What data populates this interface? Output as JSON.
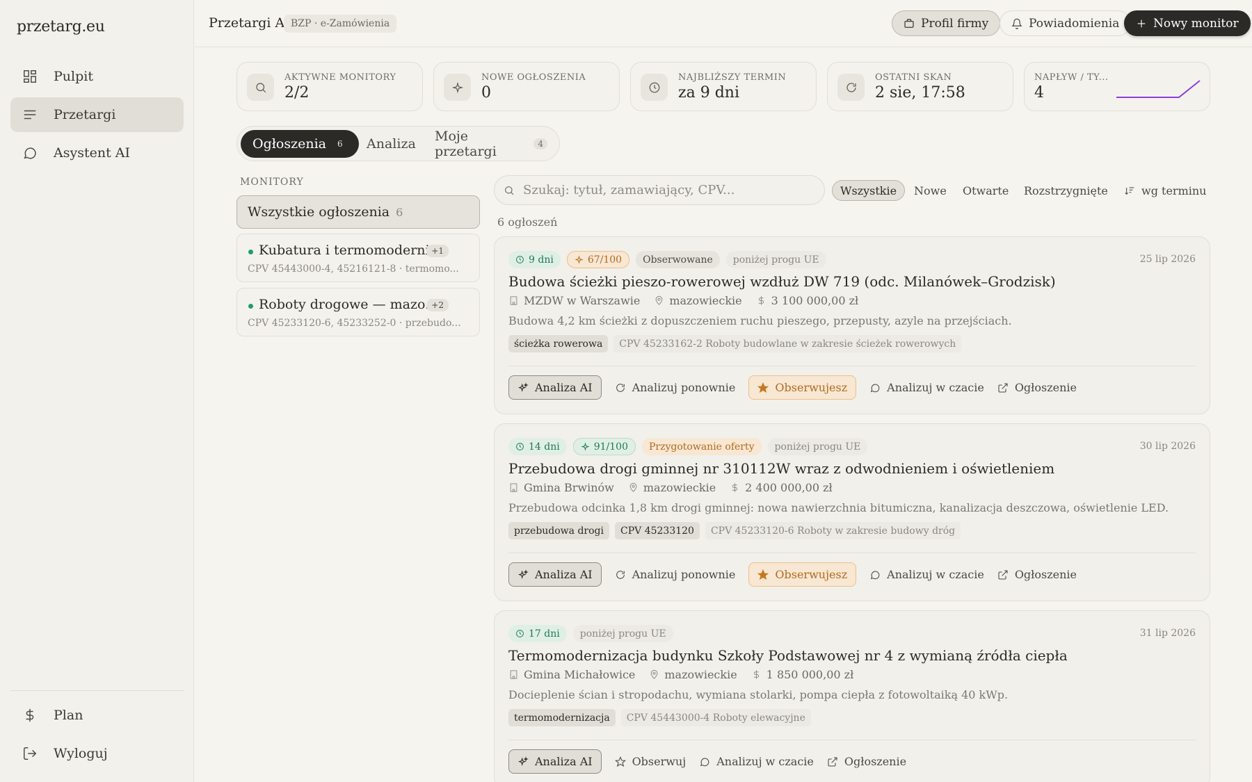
{
  "app": {
    "logo": "przetarg.eu",
    "title": "Przetargi AI",
    "source_badge": "BZP · e-Zamówienia"
  },
  "sidebar": {
    "items": [
      {
        "label": "Pulpit",
        "icon": "dashboard-icon"
      },
      {
        "label": "Przetargi",
        "icon": "list-icon",
        "active": true
      },
      {
        "label": "Asystent AI",
        "icon": "chat-icon"
      }
    ],
    "bottom": [
      {
        "label": "Plan",
        "icon": "dollar-icon"
      },
      {
        "label": "Wyloguj",
        "icon": "logout-icon"
      }
    ]
  },
  "header": {
    "profile_label": "Profil firmy",
    "notifications_label": "Powiadomienia",
    "new_monitor_label": "Nowy monitor"
  },
  "stats": [
    {
      "label": "Aktywne monitory",
      "value": "2/2",
      "icon": "search-icon"
    },
    {
      "label": "Nowe ogłoszenia",
      "value": "0",
      "icon": "sparkle-icon"
    },
    {
      "label": "Najbliższy termin",
      "value": "za 9 dni",
      "icon": "clock-icon"
    },
    {
      "label": "Ostatni skan",
      "value": "2 sie, 17:58",
      "icon": "refresh-icon"
    },
    {
      "label": "Napływ / ty...",
      "value": "4",
      "icon": "sparkline"
    }
  ],
  "tabs": [
    {
      "label": "Ogłoszenia",
      "count": "6",
      "active": true
    },
    {
      "label": "Analiza",
      "count": ""
    },
    {
      "label": "Moje przetargi",
      "count": "4"
    }
  ],
  "monitors": {
    "title": "MONITORY",
    "all_label": "Wszystkie ogłoszenia",
    "all_count": "6",
    "items": [
      {
        "name": "Kubatura i termomoderni...",
        "extra": "+1",
        "cpv": "CPV 45443000-4, 45216121-8 · termomo..."
      },
      {
        "name": "Roboty drogowe — mazo...",
        "extra": "+2",
        "cpv": "CPV 45233120-6, 45233252-0 · przebudo..."
      }
    ]
  },
  "search": {
    "placeholder": "Szukaj: tytuł, zamawiający, CPV..."
  },
  "filters": [
    "Wszystkie",
    "Nowe",
    "Otwarte",
    "Rozstrzygnięte"
  ],
  "sort_label": "wg terminu",
  "results_count": "6 ogłoszeń",
  "actions": {
    "analysis": "Analiza AI",
    "reanalyze": "Analizuj ponownie",
    "watching": "Obserwujesz",
    "watch": "Obserwuj",
    "live": "Analizuj w czacie",
    "notice": "Ogłoszenie"
  },
  "tenders": [
    {
      "days": "9 dni",
      "score": "67/100",
      "status": "Obserwowane",
      "threshold": "poniżej progu UE",
      "date": "25 lip 2026",
      "title": "Budowa ścieżki pieszo-rowerowej wzdłuż DW 719 (odc. Milanówek–Grodzisk)",
      "buyer": "MZDW w Warszawie",
      "region": "mazowieckie",
      "value": "3 100 000,00 zł",
      "desc": "Budowa 4,2 km ścieżki z dopuszczeniem ruchu pieszego, przepusty, azyle na przejściach.",
      "tags": [
        {
          "text": "ścieżka rowerowa",
          "dark": true
        },
        {
          "text": "CPV 45233162-2 Roboty budowlane w zakresie ścieżek rowerowych",
          "dark": false
        }
      ]
    },
    {
      "days": "14 dni",
      "score": "91/100",
      "status": "Przygotowanie oferty",
      "threshold": "poniżej progu UE",
      "date": "30 lip 2026",
      "title": "Przebudowa drogi gminnej nr 310112W wraz z odwodnieniem i oświetleniem",
      "buyer": "Gmina Brwinów",
      "region": "mazowieckie",
      "value": "2 400 000,00 zł",
      "desc": "Przebudowa odcinka 1,8 km drogi gminnej: nowa nawierzchnia bitumiczna, kanalizacja deszczowa, oświetlenie LED.",
      "tags": [
        {
          "text": "przebudowa drogi",
          "dark": true
        },
        {
          "text": "CPV 45233120",
          "dark": true
        },
        {
          "text": "CPV 45233120-6 Roboty w zakresie budowy dróg",
          "dark": false
        }
      ]
    },
    {
      "days": "17 dni",
      "threshold": "poniżej progu UE",
      "date": "31 lip 2026",
      "title": "Termomodernizacja budynku Szkoły Podstawowej nr 4 z wymianą źródła ciepła",
      "buyer": "Gmina Michałowice",
      "region": "mazowieckie",
      "value": "1 850 000,00 zł",
      "desc": "Docieplenie ścian i stropodachu, wymiana stolarki, pompa ciepła z fotowoltaiką 40 kWp.",
      "tags": [
        {
          "text": "termomodernizacja",
          "dark": true
        },
        {
          "text": "CPV 45443000-4 Roboty elewacyjne",
          "dark": false
        }
      ]
    }
  ],
  "colors": {
    "accent": "#2b2a27",
    "positive": "#1f7a52",
    "warning": "#b46a1e",
    "sparkline": "#8b3fd9"
  }
}
